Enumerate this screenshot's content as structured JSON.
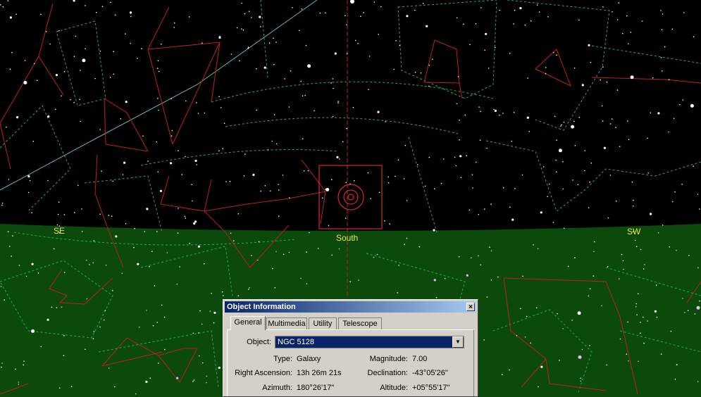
{
  "colors": {
    "sky": "#000000",
    "ground": "#0b4a0b",
    "horizon_label": "#e8e84a",
    "constellation_line": "#c02020",
    "boundary_line": "#2aa86a",
    "ecliptic": "#6fb0b0",
    "meridian": "#c02020",
    "marker": "#ff3030",
    "dialog_bg": "#d4d0c8",
    "titlebar": "#0a246a",
    "selection": "#0a246a"
  },
  "horizon": {
    "se": "SE",
    "south": "South",
    "sw": "SW"
  },
  "icons": {
    "close": "close-x-icon",
    "dropdown": "chevron-down-icon"
  },
  "dialog": {
    "title": "Object Information",
    "close_label": "×",
    "tabs": [
      {
        "label": "General",
        "active": true
      },
      {
        "label": "Multimedia",
        "active": false
      },
      {
        "label": "Utility",
        "active": false
      },
      {
        "label": "Telescope",
        "active": false
      }
    ],
    "object_label": "Object:",
    "object_value": "NGC 5128",
    "type_label": "Type:",
    "type_value": "Galaxy",
    "magnitude_label": "Magnitude:",
    "magnitude_value": "7.00",
    "ra_label": "Right Ascension:",
    "ra_value": "13h 26m 21s",
    "dec_label": "Declination:",
    "dec_value": "-43°05'26\"",
    "az_label": "Azimuth:",
    "az_value": "180°26'17\"",
    "alt_label": "Altitude:",
    "alt_value": "+05°55'17\""
  }
}
